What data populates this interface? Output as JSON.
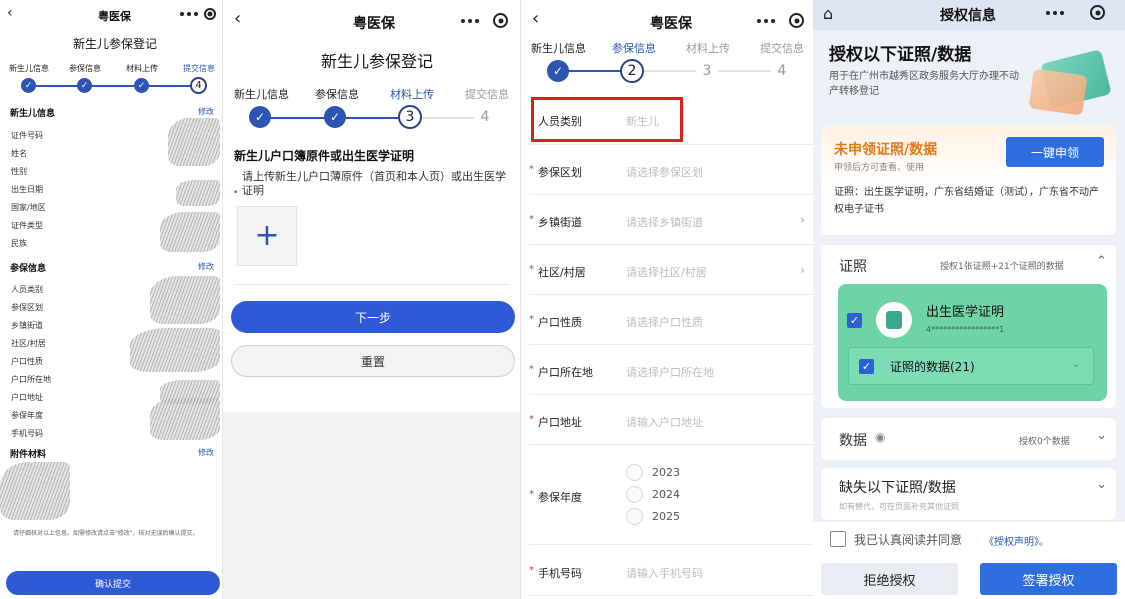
{
  "panel1": {
    "nav_title": "粤医保",
    "page_title": "新生儿参保登记",
    "steps": [
      "新生儿信息",
      "参保信息",
      "材料上传",
      "提交信息"
    ],
    "current_step_number": "4",
    "newborn_section": {
      "title": "新生儿信息",
      "edit": "修改",
      "fields": [
        "证件号码",
        "姓名",
        "性别",
        "出生日期",
        "国家/地区",
        "证件类型",
        "民族"
      ]
    },
    "insurance_section": {
      "title": "参保信息",
      "edit": "修改",
      "fields": [
        "人员类别",
        "参保区划",
        "乡镇街道",
        "社区/村居",
        "户口性质",
        "户口所在地",
        "户口地址",
        "参保年度",
        "手机号码"
      ]
    },
    "attachments_section": {
      "title": "附件材料",
      "edit": "修改"
    },
    "notice": "请仔细核对以上信息。如需修改请点击\"修改\"，核对无误后确认提交。",
    "submit_button": "确认提交"
  },
  "panel2": {
    "nav_title": "粤医保",
    "page_title": "新生儿参保登记",
    "steps": [
      "新生儿信息",
      "参保信息",
      "材料上传",
      "提交信息"
    ],
    "current_step_number": "3",
    "pending_step_number": "4",
    "upload_title": "新生儿户口簿原件或出生医学证明",
    "upload_hint": "请上传新生儿户口薄原件（首页和本人页）或出生医学证明",
    "next_button": "下一步",
    "reset_button": "重置"
  },
  "panel3": {
    "nav_title": "粤医保",
    "steps": [
      "新生儿信息",
      "参保信息",
      "材料上传",
      "提交信息"
    ],
    "current_step_number": "2",
    "pending_step_numbers": [
      "3",
      "4"
    ],
    "person_category": {
      "label": "人员类别",
      "value": "新生儿"
    },
    "fields": [
      {
        "label": "参保区划",
        "placeholder": "请选择参保区划"
      },
      {
        "label": "乡镇街道",
        "placeholder": "请选择乡镇街道"
      },
      {
        "label": "社区/村居",
        "placeholder": "请选择社区/村居"
      },
      {
        "label": "户口性质",
        "placeholder": "请选择户口性质"
      },
      {
        "label": "户口所在地",
        "placeholder": "请选择户口所在地"
      },
      {
        "label": "户口地址",
        "placeholder": "请输入户口地址"
      }
    ],
    "year": {
      "label": "参保年度",
      "options": [
        "2023",
        "2024",
        "2025"
      ]
    },
    "phone": {
      "label": "手机号码",
      "placeholder": "请输入手机号码"
    }
  },
  "panel4": {
    "nav_title": "授权信息",
    "heading": "授权以下证照/数据",
    "sub": "用于在广州市越秀区政务服务大厅办理不动产转移登记",
    "unclaimed_title": "未申领证照/数据",
    "unclaimed_sub": "申领后方可查看、使用",
    "apply_button": "一键申领",
    "unclaimed_list": "证照：出生医学证明，广东省结婚证（测试），广东省不动产权电子证书",
    "license_section": {
      "title": "证照",
      "summary": "授权1张证照+21个证照的数据"
    },
    "license_item": {
      "name": "出生医学证明",
      "number": "4*****************1"
    },
    "license_data": "证照的数据(21)",
    "data_section": {
      "title": "数据",
      "summary": "授权0个数据"
    },
    "missing_title": "缺失以下证照/数据",
    "missing_sub": "如有替代，可在页面补充其他证照",
    "agree_text": "我已认真阅读并同意",
    "agree_link": "《授权声明》。",
    "reject_button": "拒绝授权",
    "sign_button": "签署授权"
  },
  "colors": {
    "primary": "#2f5ad6",
    "step": "#2c55b4",
    "highlight_box": "#d9221c",
    "license_card": "#6fd3a8",
    "unclaimed_accent": "#e07a1a"
  }
}
